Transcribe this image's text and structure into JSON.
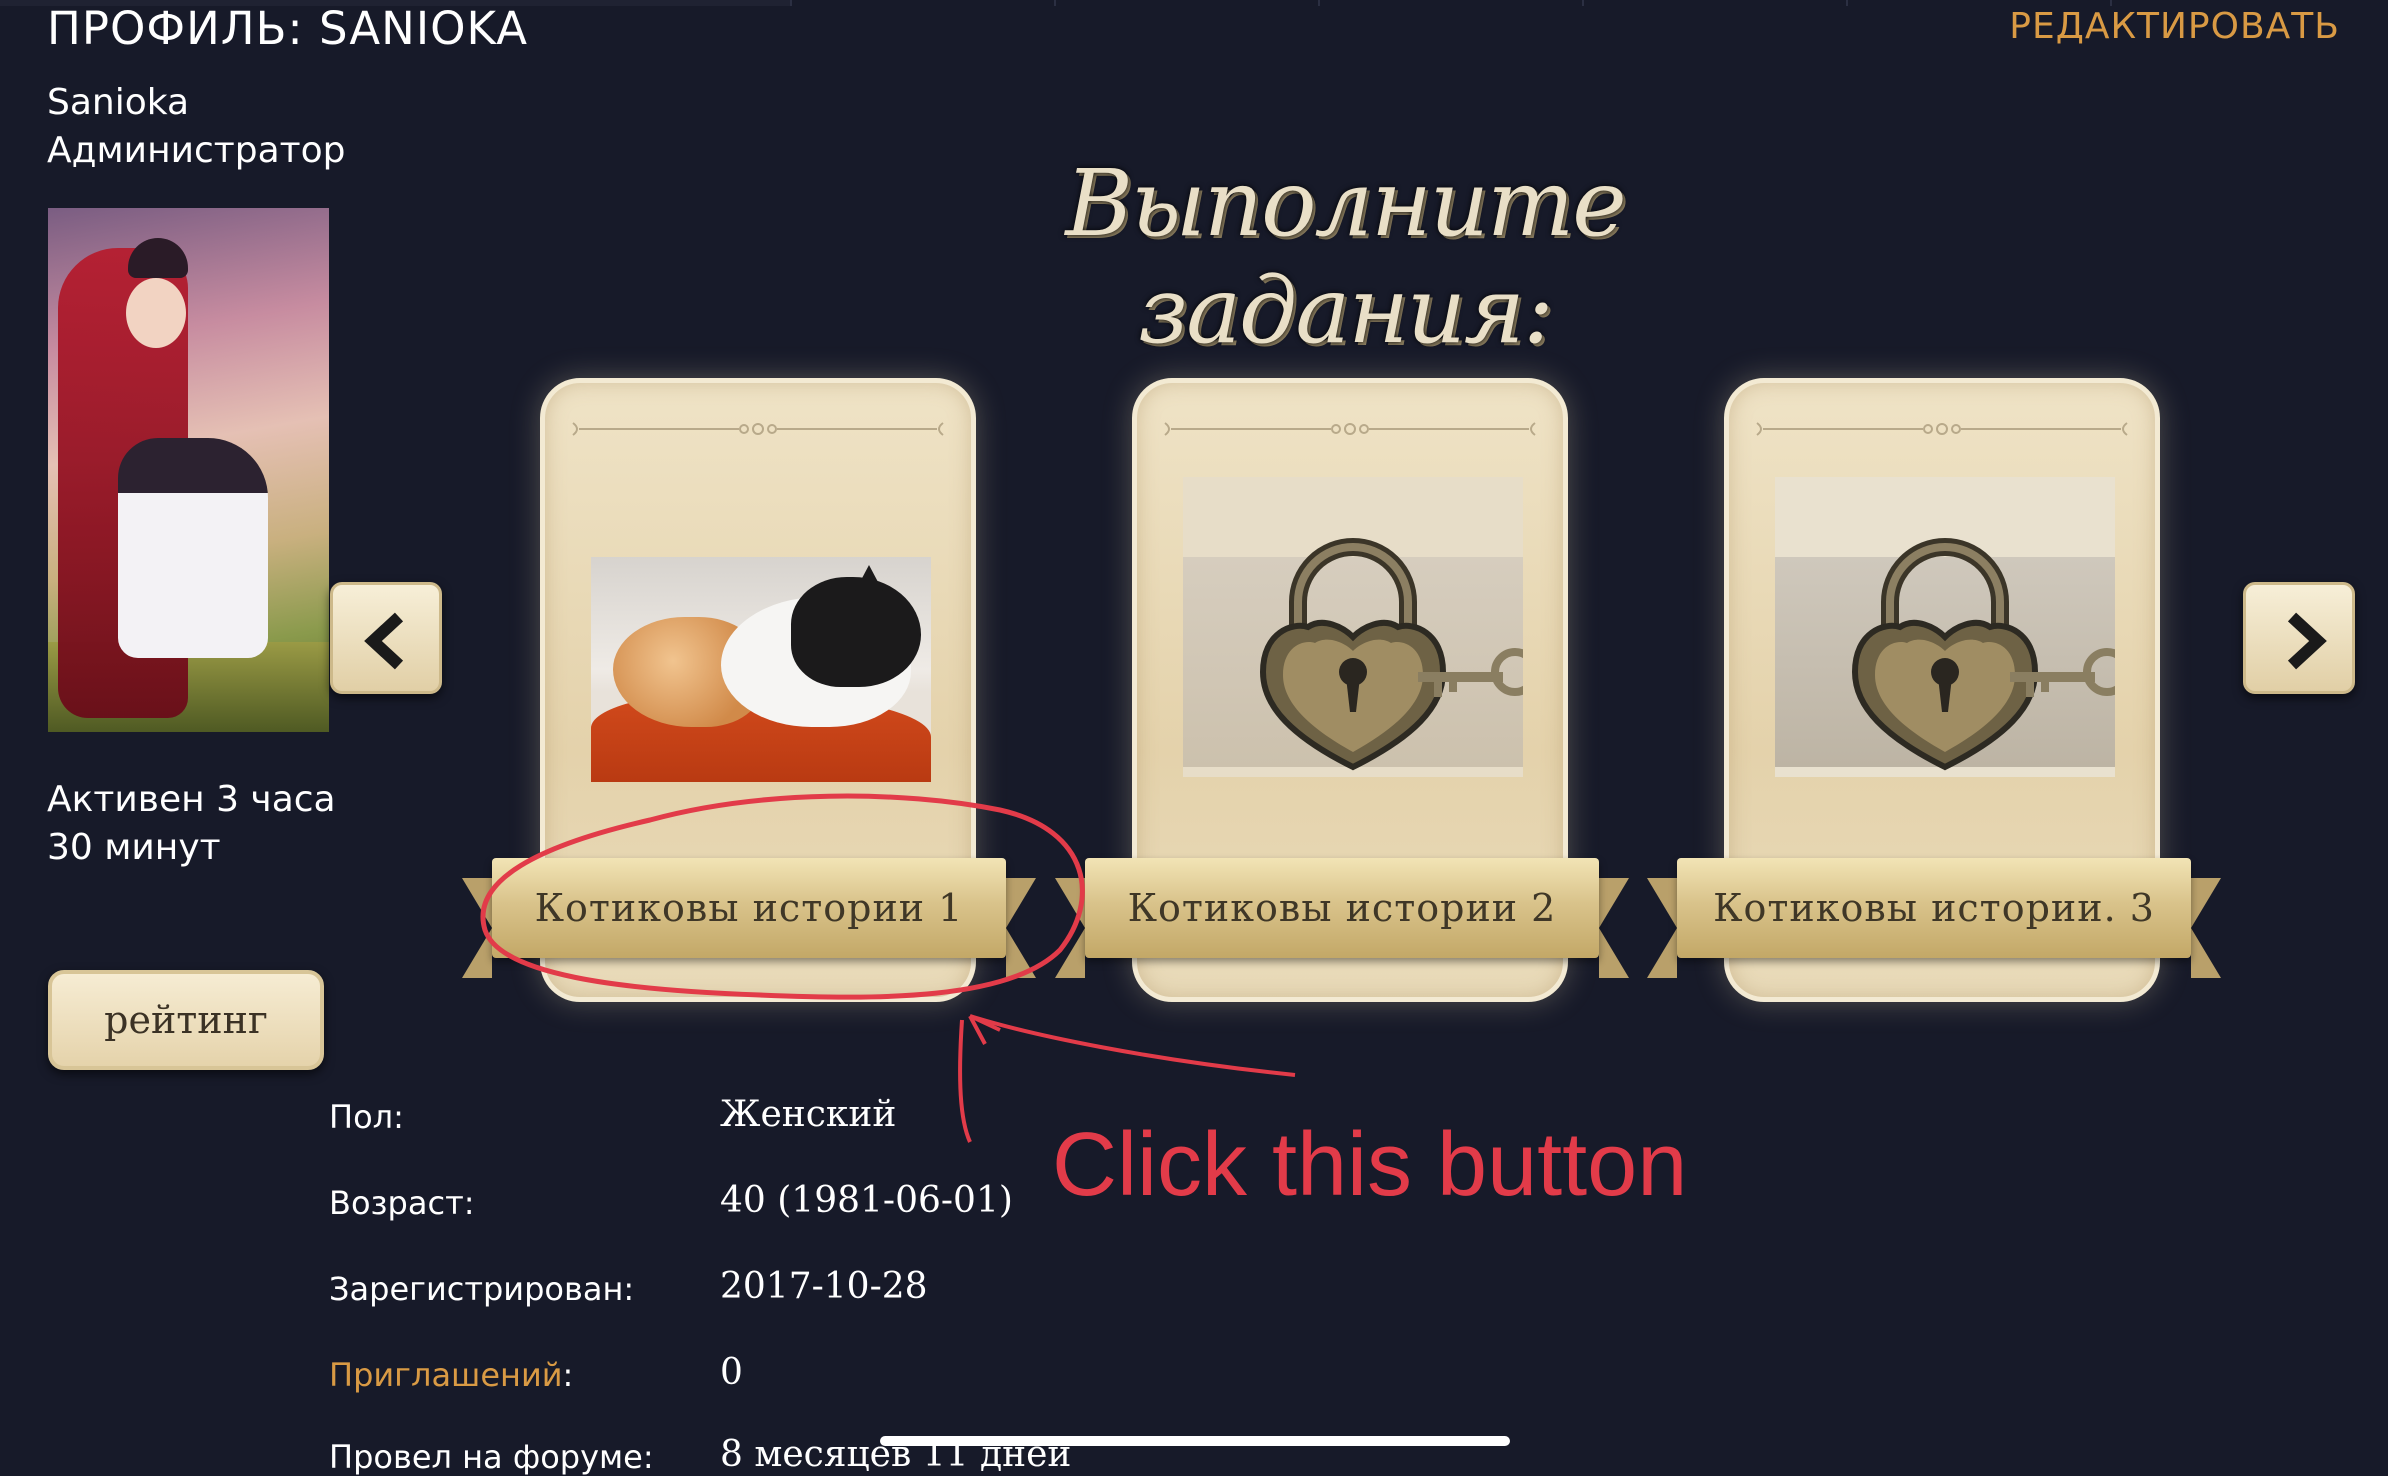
{
  "header": {
    "title": "ПРОФИЛЬ: SANIOKA",
    "edit_label": "РЕДАКТИРОВАТЬ"
  },
  "user": {
    "name": "Sanioka",
    "role": "Администратор",
    "status_line1": "Активен 3 часа",
    "status_line2": "30 минут",
    "rating_label": "рейтинг"
  },
  "tasks": {
    "heading": "Выполните задания:",
    "cards": [
      {
        "label": "Котиковы истории 1",
        "locked": false,
        "image": "cats-photo"
      },
      {
        "label": "Котиковы истории 2",
        "locked": true,
        "image": "padlock-icon"
      },
      {
        "label": "Котиковы истории. 3",
        "locked": true,
        "image": "padlock-icon"
      }
    ]
  },
  "info": [
    {
      "label": "Пол:",
      "value": "Женский"
    },
    {
      "label": "Возраст:",
      "value": "40 (1981-06-01)"
    },
    {
      "label": "Зарегистрирован:",
      "value": "2017-10-28"
    },
    {
      "label": "Приглашений",
      "suffix": ":",
      "value": "0"
    },
    {
      "label": "Провел на форуме:",
      "value": "8 месяцев 11 дней"
    }
  ],
  "annotation": {
    "text": "Click this button",
    "color": "#e23b49"
  },
  "colors": {
    "background": "#171a29",
    "accent": "#d99a44",
    "card": "#e9dbba"
  }
}
